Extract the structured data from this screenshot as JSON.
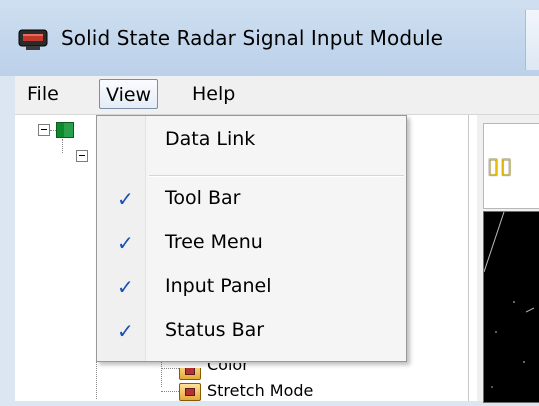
{
  "window": {
    "title": "Solid State Radar Signal Input Module"
  },
  "menubar": {
    "file": "File",
    "view": "View",
    "help": "Help"
  },
  "view_menu": {
    "items": [
      {
        "label": "Data Link",
        "checked": false
      },
      {
        "label": "Tool Bar",
        "checked": true
      },
      {
        "label": "Tree Menu",
        "checked": true
      },
      {
        "label": "Input Panel",
        "checked": true
      },
      {
        "label": "Status Bar",
        "checked": true
      }
    ],
    "check_glyph": "✓"
  },
  "tree": {
    "partial_node": "Color",
    "last_node": "Stretch Mode"
  },
  "right_panel": {
    "glyph": "▯▯"
  },
  "colors": {
    "check": "#1a4eb0",
    "indicator": "#e8c000"
  }
}
